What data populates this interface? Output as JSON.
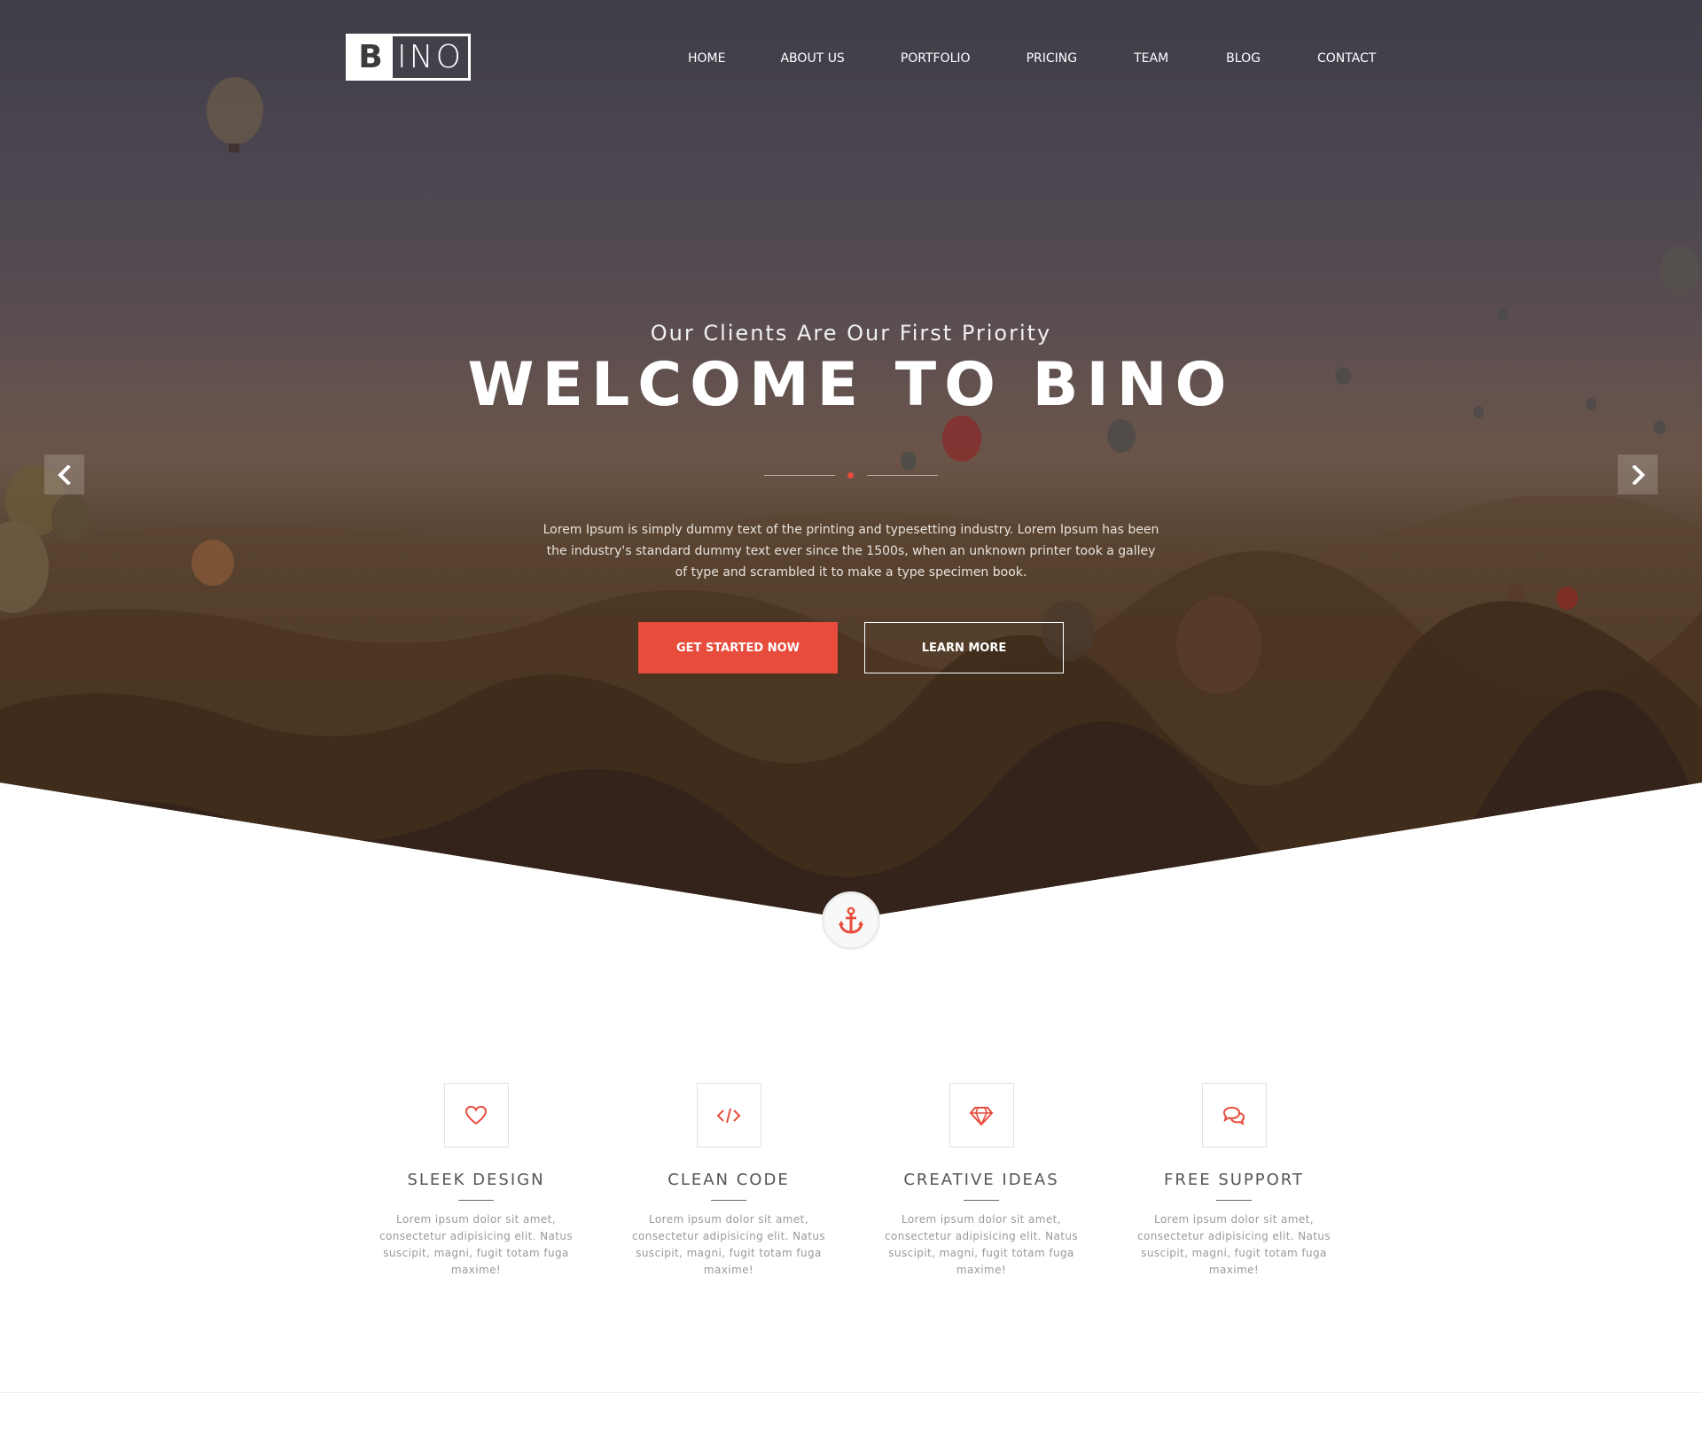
{
  "brand": {
    "logo_letter": "B",
    "logo_rest": "INO"
  },
  "nav": {
    "items": [
      {
        "label": "HOME"
      },
      {
        "label": "ABOUT US"
      },
      {
        "label": "PORTFOLIO"
      },
      {
        "label": "PRICING"
      },
      {
        "label": "TEAM"
      },
      {
        "label": "BLOG"
      },
      {
        "label": "CONTACT"
      }
    ]
  },
  "hero": {
    "subtitle": "Our Clients Are Our First Priority",
    "title": "WELCOME TO BINO",
    "text": "Lorem Ipsum is simply dummy text of the printing and typesetting industry. Lorem Ipsum has been the industry's standard dummy text ever since the 1500s, when an unknown printer took a galley of type and scrambled it to make a type specimen book.",
    "primary_button": "GET STARTED NOW",
    "secondary_button": "LEARN MORE"
  },
  "features": [
    {
      "icon": "heart-icon",
      "title": "SLEEK DESIGN",
      "text": "Lorem ipsum dolor sit amet, consectetur adipisicing elit. Natus suscipit, magni, fugit totam fuga maxime!"
    },
    {
      "icon": "code-icon",
      "title": "CLEAN CODE",
      "text": "Lorem ipsum dolor sit amet, consectetur adipisicing elit. Natus suscipit, magni, fugit totam fuga maxime!"
    },
    {
      "icon": "diamond-icon",
      "title": "CREATIVE IDEAS",
      "text": "Lorem ipsum dolor sit amet, consectetur adipisicing elit. Natus suscipit, magni, fugit totam fuga maxime!"
    },
    {
      "icon": "chat-icon",
      "title": "FREE SUPPORT",
      "text": "Lorem ipsum dolor sit amet, consectetur adipisicing elit. Natus suscipit, magni, fugit totam fuga maxime!"
    }
  ],
  "colors": {
    "accent": "#e74c3c",
    "text_muted": "#999999",
    "heading": "#555555"
  }
}
